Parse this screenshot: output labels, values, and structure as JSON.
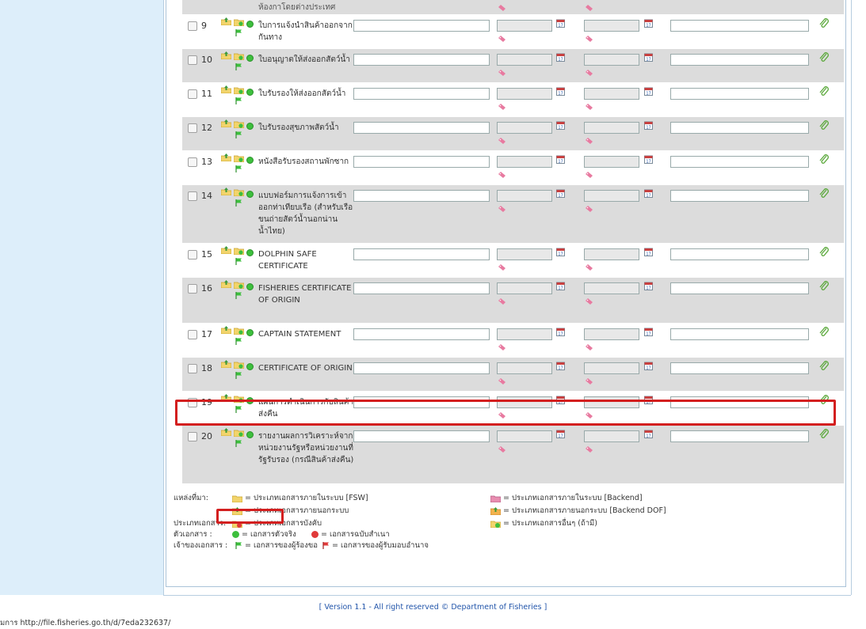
{
  "top_partial_row": {
    "name": "ห้องกาโดยต่างประเทศ"
  },
  "rows": [
    {
      "num": "9",
      "name": "ใบการแจ้งนำสินค้าออกจากกันทาง",
      "h": 42,
      "shade": "white"
    },
    {
      "num": "10",
      "name": "ใบอนุญาตให้ส่งออกสัตว์น้ำ",
      "h": 42,
      "shade": "gray"
    },
    {
      "num": "11",
      "name": "ใบรับรองให้ส่งออกสัตว์น้ำ",
      "h": 42,
      "shade": "white"
    },
    {
      "num": "12",
      "name": "ใบรับรองสุขภาพสัตว์น้ำ",
      "h": 42,
      "shade": "gray"
    },
    {
      "num": "13",
      "name": "หนังสือรับรองสถานพักซาก",
      "h": 42,
      "shade": "white"
    },
    {
      "num": "14",
      "name": "แบบฟอร์มการแจ้งการเข้าออกท่าเทียบเรือ (สำหรับเรือขนถ่ายสัตว์น้ำนอกน่านน้ำไทย)",
      "h": 73,
      "shade": "gray"
    },
    {
      "num": "15",
      "name": "DOLPHIN SAFE CERTIFICATE",
      "h": 42,
      "shade": "white"
    },
    {
      "num": "16",
      "name": "FISHERIES CERTIFICATE OF ORIGIN",
      "h": 57,
      "shade": "gray"
    },
    {
      "num": "17",
      "name": "CAPTAIN STATEMENT",
      "h": 42,
      "shade": "white"
    },
    {
      "num": "18",
      "name": "CERTIFICATE OF ORIGIN",
      "h": 42,
      "shade": "gray"
    },
    {
      "num": "19",
      "name": "แผนการดำเนินการกับสินค้าส่งคืน",
      "h": 42,
      "shade": "white"
    },
    {
      "num": "20",
      "name": "รายงานผลการวิเคราะห์จากหน่วยงานรัฐหรือหน่วยงานที่รัฐรับรอง (กรณีสินค้าส่งคืน)",
      "h": 73,
      "shade": "gray"
    }
  ],
  "legend": {
    "source_label": "แหล่งที่มา:",
    "src_fsw": "= ประเภทเอกสารภายในระบบ [FSW]",
    "src_outside": "= ประเภทเอกสารภายนอกระบบ",
    "src_backend": "= ประเภทเอกสารภายในระบบ [Backend]",
    "src_backend_dof": "= ประเภทเอกสารภายนอกระบบ [Backend DOF]",
    "type_label": "ประเภทเอกสาร:",
    "type_required": "= ประเภทเอกสารบังคับ",
    "type_other": "= ประเภทเอกสารอื่นๆ (ถ้ามี)",
    "body_label": "ตัวเอกสาร :",
    "body_original": "= เอกสารตัวจริง",
    "body_copy": "= เอกสารฉบับสำเนา",
    "owner_label": "เจ้าของเอกสาร :",
    "owner_requester": "= เอกสารของผู้ร้องขอ",
    "owner_delegate": "= เอกสารของผู้รับมอบอำนาจ"
  },
  "footer": {
    "version": "[ Version 1.1 - All right reserved © Department of Fisheries ]"
  },
  "status_bar": {
    "url": "มการ http://file.fisheries.go.th/d/7eda232637/"
  },
  "colors": {
    "highlight": "#d31f1f",
    "green_dot": "#3dbf3d",
    "red_dot": "#e03a3a",
    "sidebar_bg": "#ddeefa"
  }
}
